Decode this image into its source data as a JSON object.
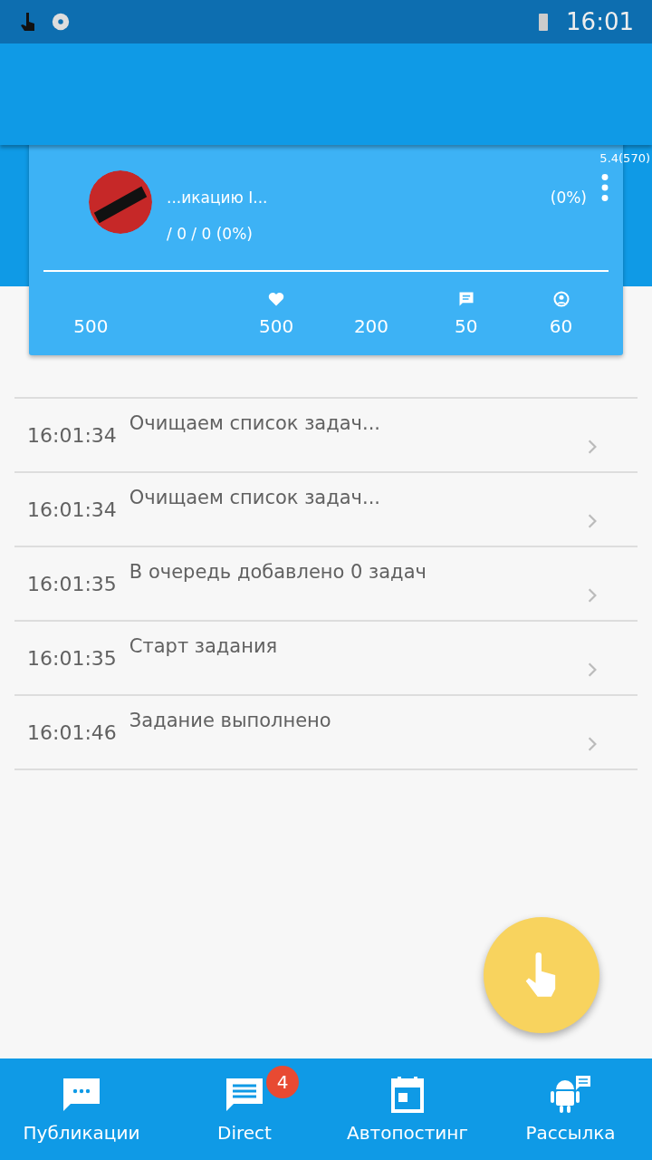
{
  "status_bar": {
    "time": "16:01"
  },
  "header": {
    "version": "5.4(570)"
  },
  "card": {
    "line_1": "...икацию I...",
    "line_1_end": "(0%)",
    "line_2": "/ 0 / 0 (0%)",
    "stats": [
      {
        "value": "500"
      },
      {
        "value": "500"
      },
      {
        "value": "200"
      },
      {
        "value": "50"
      },
      {
        "value": "60"
      }
    ]
  },
  "log": [
    {
      "time": "16:01:34",
      "message": "Очищаем список задач..."
    },
    {
      "time": "16:01:34",
      "message": "Очищаем список задач..."
    },
    {
      "time": "16:01:35",
      "message": "В очередь добавлено 0 задач"
    },
    {
      "time": "16:01:35",
      "message": "Старт задания"
    },
    {
      "time": "16:01:46",
      "message": "Задание выполнено"
    }
  ],
  "bottom_nav": [
    {
      "label": "Публикации"
    },
    {
      "label": "Direct",
      "badge": "4"
    },
    {
      "label": "Автопостинг"
    },
    {
      "label": "Рассылка"
    }
  ]
}
